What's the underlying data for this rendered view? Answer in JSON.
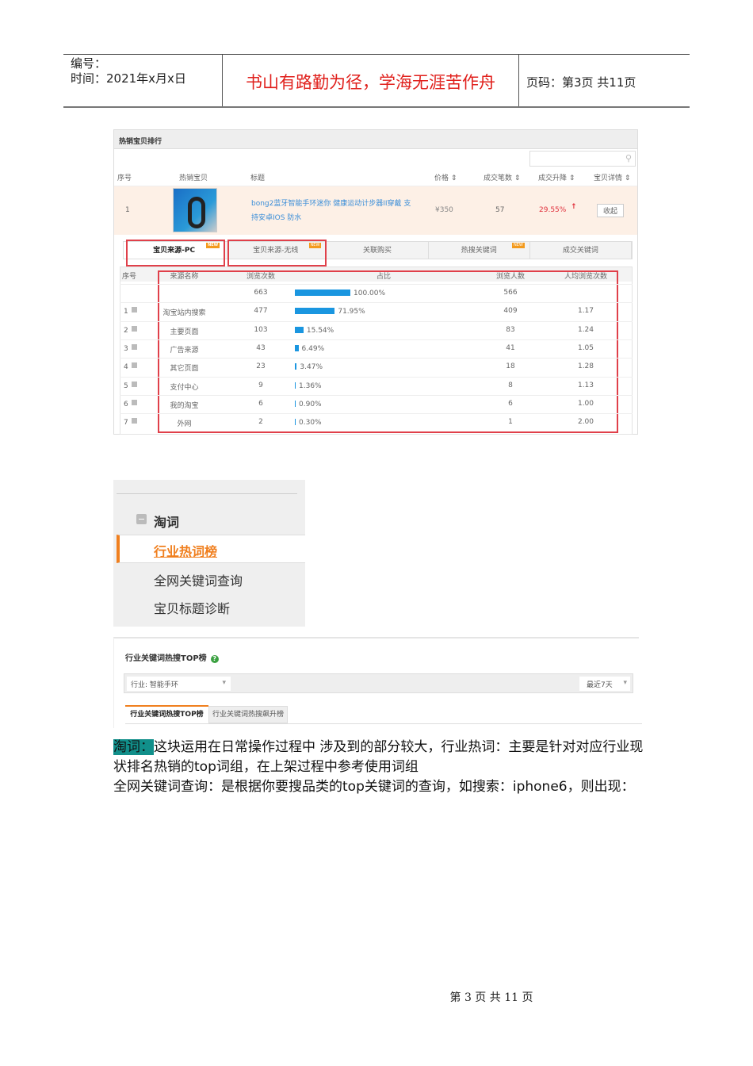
{
  "header": {
    "code_label": "编号：",
    "time_label": "时间：2021年x月x日",
    "motto": "书山有路勤为径，学海无涯苦作舟",
    "page_label": "页码：第3页 共11页"
  },
  "hot_items": {
    "title": "热销宝贝排行",
    "search_icon": "search-icon",
    "columns": [
      "序号",
      "热销宝贝",
      "标题",
      "价格 ⇕",
      "成交笔数 ⇕",
      "成交升降 ⇕",
      "宝贝详情 ⇕"
    ],
    "row": {
      "rank": "1",
      "title": "bong2蓝牙智能手环迷你 健康运动计步器II穿戴 支持安卓IOS 防水",
      "price": "¥350",
      "sales": "57",
      "change": "29.55%",
      "change_icon": "↑",
      "action": "收起"
    },
    "tabs": [
      {
        "label": "宝贝来源-PC",
        "badge": "NEW"
      },
      {
        "label": "宝贝来源-无线",
        "badge": "NEW"
      },
      {
        "label": "关联购买",
        "badge": ""
      },
      {
        "label": "热搜关键词",
        "badge": "NEW"
      },
      {
        "label": "成交关键词",
        "badge": ""
      }
    ],
    "source_columns": [
      "序号",
      "来源名称",
      "浏览次数",
      "占比",
      "浏览人数",
      "人均浏览次数"
    ],
    "source_rows": [
      {
        "no": "",
        "name": "",
        "views": "663",
        "pct": 100.0,
        "pct_label": "100.00%",
        "visitors": "566",
        "avg": ""
      },
      {
        "no": "1",
        "name": "淘宝站内搜索",
        "views": "477",
        "pct": 71.95,
        "pct_label": "71.95%",
        "visitors": "409",
        "avg": "1.17"
      },
      {
        "no": "2",
        "name": "主要页面",
        "views": "103",
        "pct": 15.54,
        "pct_label": "15.54%",
        "visitors": "83",
        "avg": "1.24"
      },
      {
        "no": "3",
        "name": "广告来源",
        "views": "43",
        "pct": 6.49,
        "pct_label": "6.49%",
        "visitors": "41",
        "avg": "1.05"
      },
      {
        "no": "4",
        "name": "其它页面",
        "views": "23",
        "pct": 3.47,
        "pct_label": "3.47%",
        "visitors": "18",
        "avg": "1.28"
      },
      {
        "no": "5",
        "name": "支付中心",
        "views": "9",
        "pct": 1.36,
        "pct_label": "1.36%",
        "visitors": "8",
        "avg": "1.13"
      },
      {
        "no": "6",
        "name": "我的淘宝",
        "views": "6",
        "pct": 0.9,
        "pct_label": "0.90%",
        "visitors": "6",
        "avg": "1.00"
      },
      {
        "no": "7",
        "name": "外网",
        "views": "2",
        "pct": 0.3,
        "pct_label": "0.30%",
        "visitors": "1",
        "avg": "2.00"
      }
    ]
  },
  "menu": {
    "group": "淘词",
    "items": [
      "行业热词榜",
      "全网关键词查询",
      "宝贝标题诊断"
    ],
    "active": 0
  },
  "top_panel": {
    "title": "行业关键词热搜TOP榜",
    "industry": "行业: 智能手环",
    "period": "最近7天",
    "tabs": [
      "行业关键词热搜TOP榜",
      "行业关键词热搜飙升榜"
    ]
  },
  "body": {
    "highlight": "淘词：",
    "line1": "这块运用在日常操作过程中 涉及到的部分较大，行业热词：主要是针对对应行业现状排名热销的top词组，在上架过程中参考使用词组",
    "line2": "全网关键词查询：是根据你要搜品类的top关键词的查询，如搜索：iphone6，则出现："
  },
  "footer": "第 3 页 共 11 页",
  "colors": {
    "motto": "#e0201c",
    "accent": "#f07f1e",
    "bar": "#1a96e0",
    "highlight_box": "#e0404a"
  }
}
